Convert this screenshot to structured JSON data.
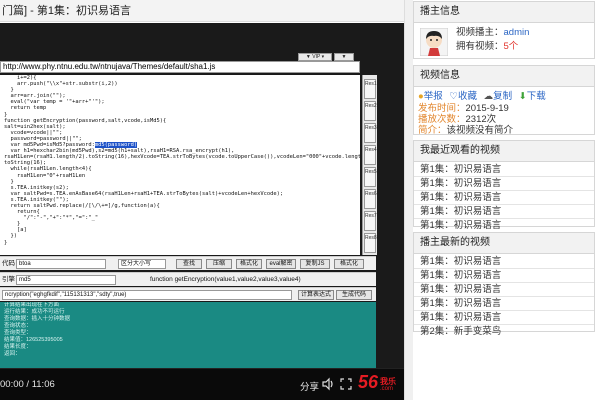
{
  "page_title": "门篇] - 第1集：初识易语言",
  "player": {
    "address": "http://www.phy.ntnu.edu.tw/ntnujava/Themes/default/sha1.js",
    "top_buttons": [
      "▼ VIP ▾",
      "▼"
    ],
    "code_lines": [
      "    i+=2){",
      "    arr.push(\"\\\\x\"+str.substr(i,2))",
      "  }",
      "  arr=arr.join(\"\");",
      "  eval(\"var temp = '\"+arr+\"'\");",
      "  return temp",
      "}",
      "function getEncryption(password,salt,vcode,isMd5){",
      "salt=uin2hex(salt);",
      "  vcode=vcode||\"\";",
      "  password=password||\"\";",
      "  var md5Pwd=isMd5?password:",
      "  var h1=hexchar2bin(md5Pwd),s2=md5(h1+salt),rsaH1=RSA.rsa_encrypt(h1),",
      "rsaH1Len=(rsaH1.length/2).toString(16),hexVcode=TEA.strToBytes(vcode.toUpperCase()),vcodeLen=\"000\"+vcode.length.",
      "toString(16);",
      "  while(rsaH1Len.length<4){",
      "    rsaH1Len=\"0\"+rsaH1Len",
      "  }",
      "  s.TEA.initkey(s2);",
      "  var saltPwd=s.TEA.enAsBase64(rsaH1Len+rsaH1+TEA.strToBytes(salt)+vcodeLen+hexVcode);",
      "  s.TEA.initkey(\"\");",
      "  return saltPwd.replace(/[\\/\\+=]/g,function(a){",
      "    return{",
      "      \"/\":\"-\",\"+\":\"*\",\"=\":\"_\"",
      "    }",
      "    [a]",
      "  })",
      "}"
    ],
    "code_highlight": "md5(password)",
    "side_tabs": [
      "Res1",
      "Res2",
      "Res3",
      "Res4",
      "Res5",
      "Res6",
      "Res7",
      "Res8"
    ],
    "row1": {
      "label": "代码",
      "input": "btoa",
      "select": "区分大小写",
      "buttons": [
        "查找",
        "压缩",
        "格式化",
        "eval解密",
        "复制JS",
        "格式化"
      ]
    },
    "row2": {
      "label": "引擎",
      "input": "md5",
      "function_text": "function getEncryption(value1,value2,value3,value4)"
    },
    "row3": {
      "input": "ncryption(\"eghgfkdif\",\"115131313\",\"sdty\",true)",
      "buttons": [
        "计算表达式",
        "生成代码"
      ]
    },
    "result_lines": [
      "计算结果出现在下方面",
      "运行结果：成功不可运行",
      "查询数据：插入十分钟数据",
      "查询状态：",
      "查询类型：",
      "结果值：126525395005",
      "结果长度：",
      "返回："
    ],
    "time": "00:00 / 11:06",
    "share_label": "分享",
    "logo_num": "56",
    "logo_word": "我乐",
    "logo_com": ".com"
  },
  "uploader": {
    "header": "播主信息",
    "name_label": "视频播主：",
    "name": "admin",
    "count_label": "拥有视频：",
    "count": "5个"
  },
  "video_info": {
    "header": "视频信息",
    "actions": [
      "举报",
      "收藏",
      "复制",
      "下载"
    ],
    "publish_label": "发布时间：",
    "publish": "2015-9-19",
    "plays_label": "播放次数：",
    "plays": "2312次",
    "intro_label": "简介：",
    "intro": "该视频没有简介"
  },
  "recent_watched": {
    "header": "我最近观看的视频",
    "items": [
      "第1集：初识易语言",
      "第1集：初识易语言",
      "第1集：初识易语言",
      "第1集：初识易语言",
      "第1集：初识易语言"
    ]
  },
  "latest": {
    "header": "播主最新的视频",
    "items": [
      "第1集：初识易语言",
      "第1集：初识易语言",
      "第1集：初识易语言",
      "第1集：初识易语言",
      "第1集：初识易语言",
      "第2集：新手变菜鸟"
    ]
  },
  "colors": {
    "accent_red": "#e2322b",
    "link_blue": "#2a65c4",
    "result_teal": "#1a8a83",
    "logo_red": "#e51c23"
  }
}
